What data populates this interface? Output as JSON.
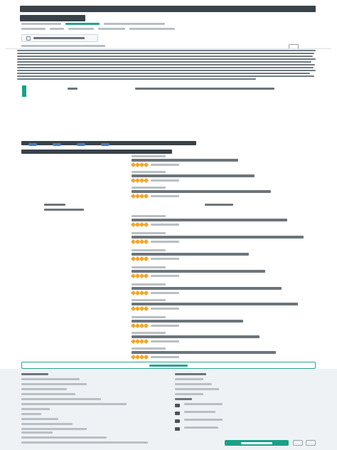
{
  "accent_color": "#1aa08a",
  "star_color": "#f5a623",
  "star_rating": 4,
  "suggestion_count": 13,
  "footer_link_count": 9,
  "footer_support_link_count": 4
}
